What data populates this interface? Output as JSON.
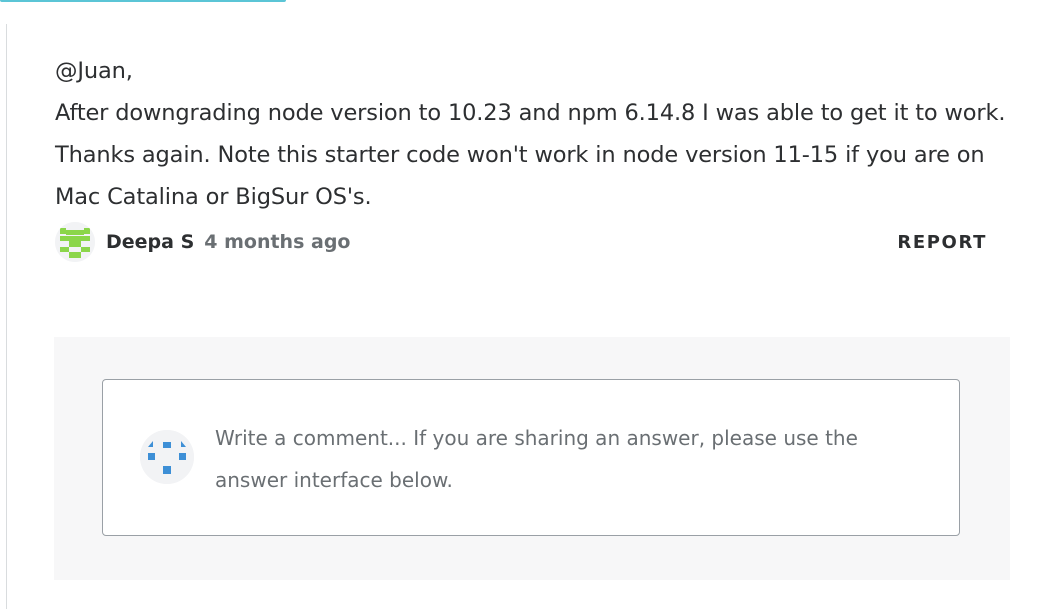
{
  "comment": {
    "lines": [
      "@Juan,",
      "After downgrading node version to 10.23 and npm 6.14.8 I was able to get it to work.",
      "Thanks again. Note this starter code won't work in node version 11-15 if you are on",
      "Mac Catalina or BigSur OS's."
    ],
    "author": "Deepa S",
    "time": "4 months ago",
    "report_label": "REPORT",
    "author_avatar_icon": "identicon-green"
  },
  "composer": {
    "placeholder": "Write a comment... If you are sharing an answer, please use the answer interface below.",
    "avatar_icon": "identicon-blue"
  },
  "colors": {
    "accent": "#5bc5d6",
    "author_identicon": "#8bd64a",
    "user_identicon": "#3d8fd6",
    "composer_bg": "#f7f7f8"
  }
}
